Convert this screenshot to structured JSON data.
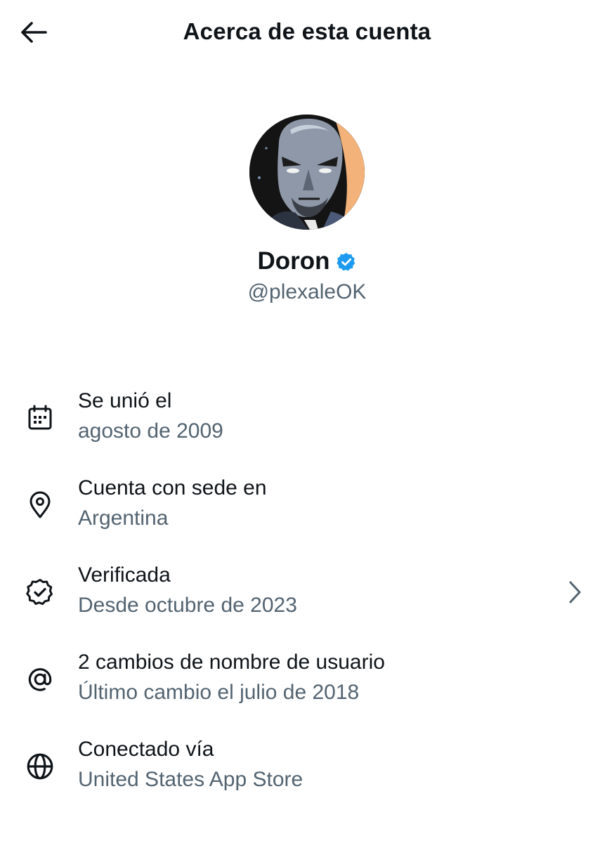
{
  "header": {
    "title": "Acerca de esta cuenta",
    "back_icon": "arrow-left-icon"
  },
  "profile": {
    "name": "Doron",
    "handle": "@plexaleOK",
    "verified": true,
    "badge_color": "#1d9bf0"
  },
  "items": [
    {
      "icon": "calendar-icon",
      "title": "Se unió el",
      "subtitle": "agosto de 2009"
    },
    {
      "icon": "location-pin-icon",
      "title": "Cuenta con sede en",
      "subtitle": "Argentina"
    },
    {
      "icon": "verified-badge-outline-icon",
      "title": "Verificada",
      "subtitle": "Desde octubre de 2023",
      "has_chevron": true
    },
    {
      "icon": "at-sign-icon",
      "title": "2 cambios de nombre de usuario",
      "subtitle": "Último cambio el julio de 2018"
    },
    {
      "icon": "globe-icon",
      "title": "Conectado vía",
      "subtitle": "United States App Store"
    }
  ],
  "colors": {
    "text_primary": "#0f1419",
    "text_secondary": "#536471",
    "accent": "#1d9bf0"
  }
}
